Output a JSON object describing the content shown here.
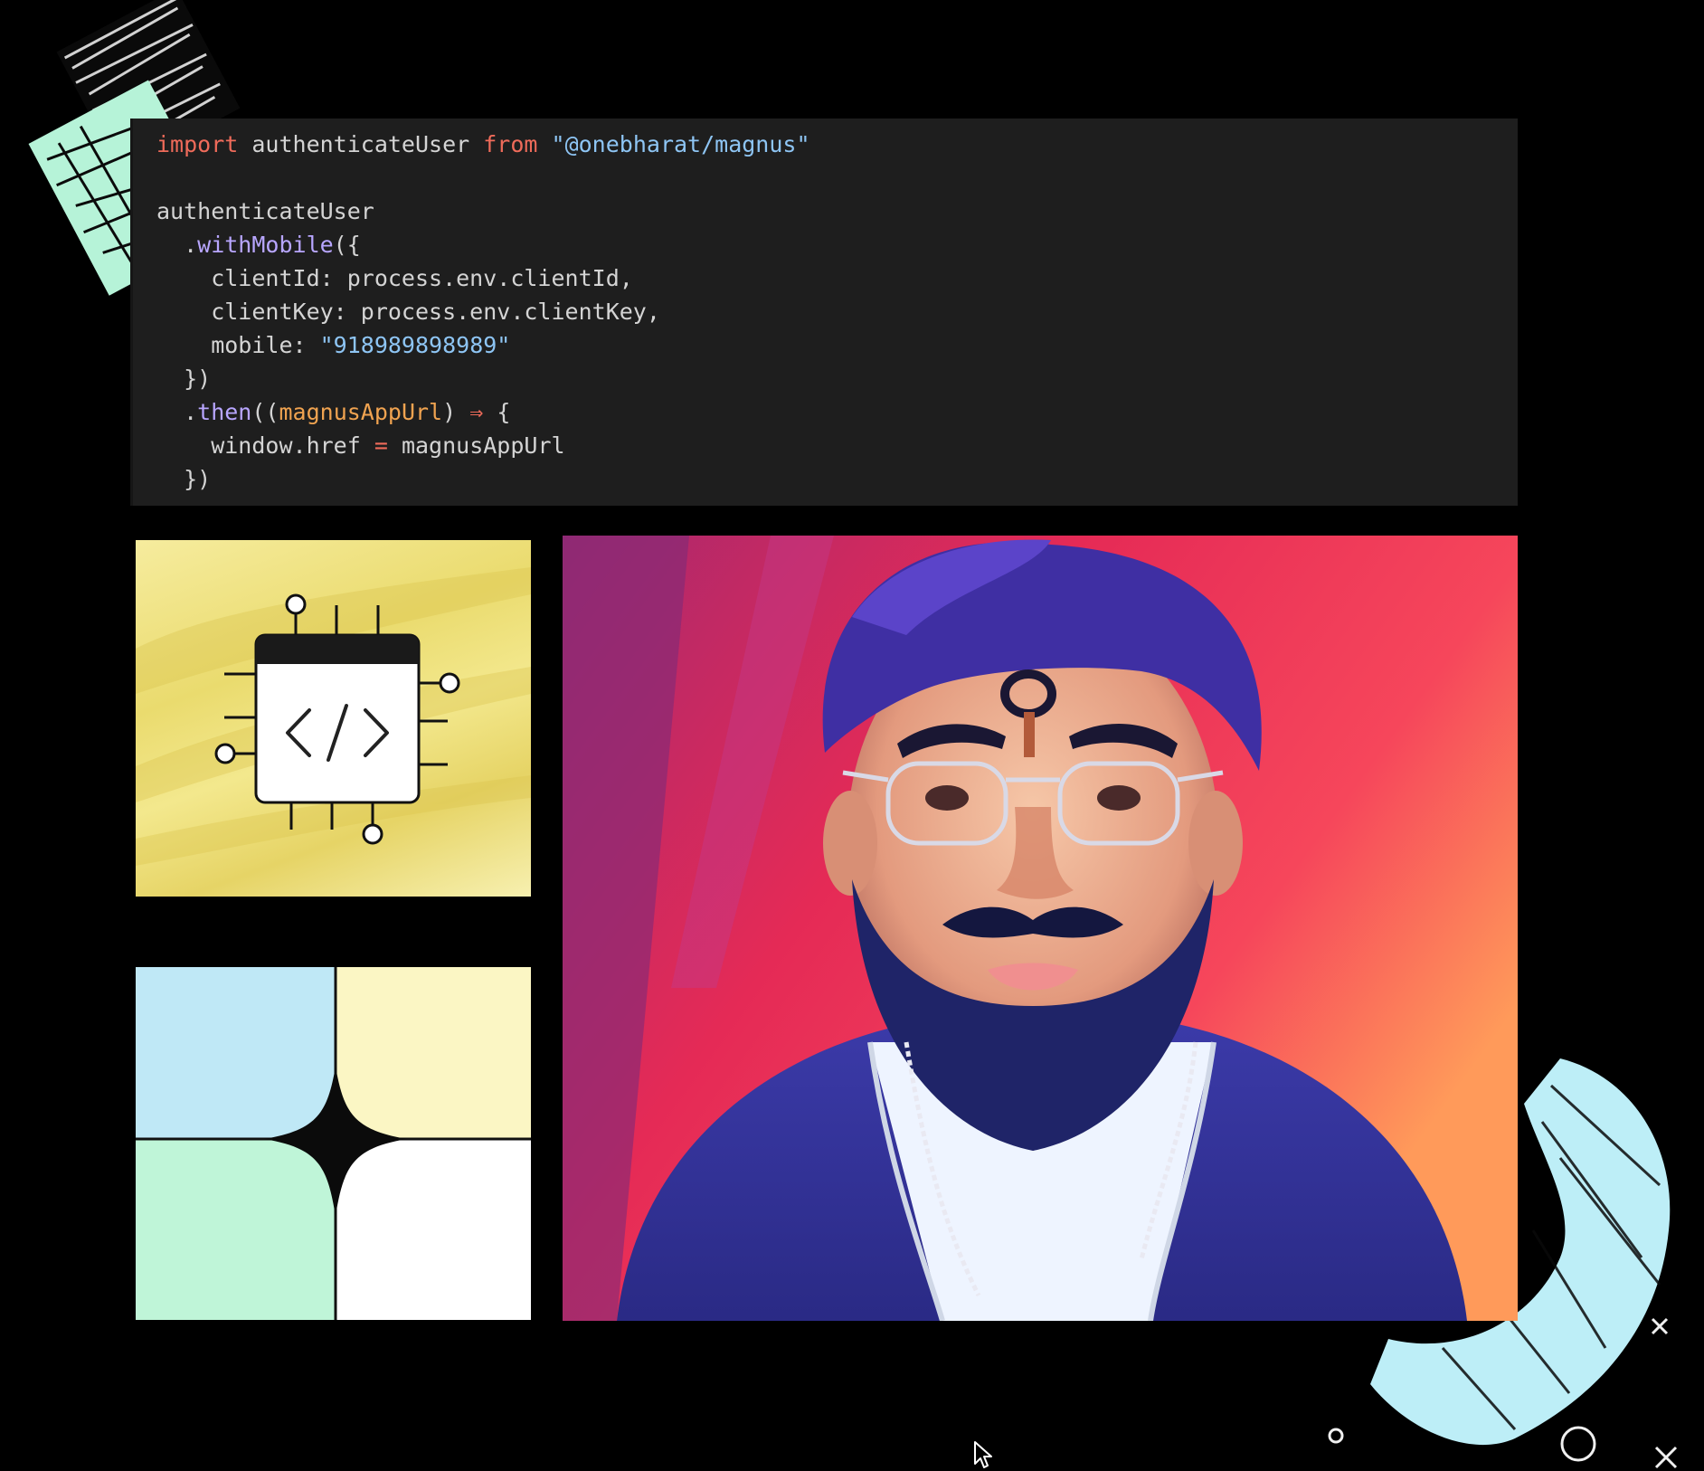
{
  "code": {
    "lines": [
      [
        {
          "t": "import",
          "c": "kw"
        },
        {
          "t": " authenticateUser ",
          "c": "plain"
        },
        {
          "t": "from",
          "c": "kw"
        },
        {
          "t": " ",
          "c": "plain"
        },
        {
          "t": "\"@onebharat/magnus\"",
          "c": "str"
        }
      ],
      [],
      [
        {
          "t": "authenticateUser",
          "c": "plain"
        }
      ],
      [
        {
          "t": "  .",
          "c": "plain"
        },
        {
          "t": "withMobile",
          "c": "fn"
        },
        {
          "t": "({",
          "c": "plain"
        }
      ],
      [
        {
          "t": "    clientId: process.env.clientId,",
          "c": "plain"
        }
      ],
      [
        {
          "t": "    clientKey: process.env.clientKey,",
          "c": "plain"
        }
      ],
      [
        {
          "t": "    mobile: ",
          "c": "plain"
        },
        {
          "t": "\"918989898989\"",
          "c": "str"
        }
      ],
      [
        {
          "t": "  })",
          "c": "plain"
        }
      ],
      [
        {
          "t": "  .",
          "c": "plain"
        },
        {
          "t": "then",
          "c": "fn"
        },
        {
          "t": "((",
          "c": "plain"
        },
        {
          "t": "magnusAppUrl",
          "c": "param"
        },
        {
          "t": ") ",
          "c": "plain"
        },
        {
          "t": "⇒",
          "c": "op"
        },
        {
          "t": " {",
          "c": "plain"
        }
      ],
      [
        {
          "t": "    window.href ",
          "c": "plain"
        },
        {
          "t": "=",
          "c": "op"
        },
        {
          "t": " magnusAppUrl",
          "c": "plain"
        }
      ],
      [
        {
          "t": "  })",
          "c": "plain"
        }
      ]
    ]
  },
  "colors": {
    "background": "#000000",
    "code_bg": "#1e1e1e",
    "mint_brush": "#b6f3d8",
    "cyan_brush": "#bdeef7",
    "chip_tile_yellow": "#efe27c",
    "grid_blue": "#bfe8f6",
    "grid_yellow": "#fbf6c4",
    "grid_green": "#bff5d8",
    "grid_white": "#ffffff"
  },
  "icons": {
    "chip": "code-chip-icon",
    "star": "four-point-star-icon",
    "cursor": "mouse-pointer-icon"
  }
}
